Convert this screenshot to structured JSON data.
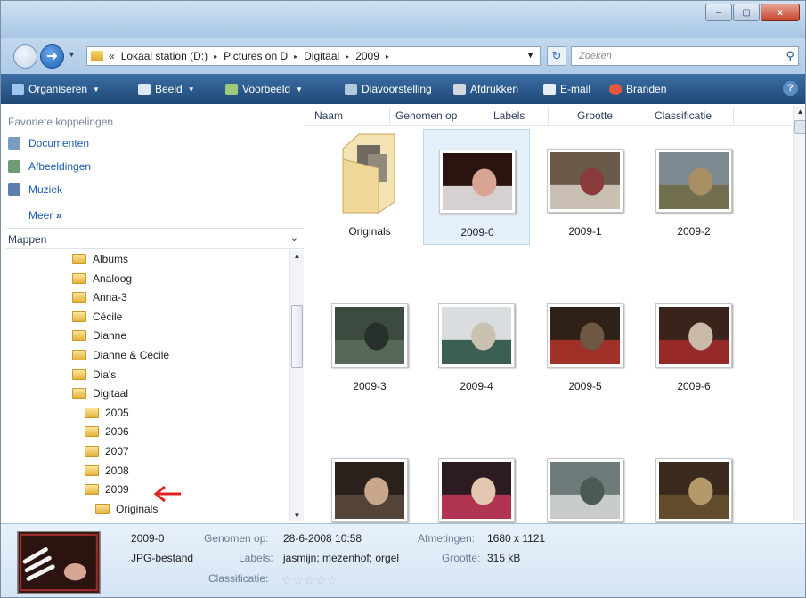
{
  "window": {
    "controls": {
      "minimize": "–",
      "maximize": "▢",
      "close": "x"
    }
  },
  "address_bar": {
    "overflow": "«",
    "crumbs": [
      "Lokaal station (D:)",
      "Pictures on D",
      "Digitaal",
      "2009"
    ],
    "separator": "▸",
    "search_placeholder": "Zoeken"
  },
  "toolbar": {
    "items": [
      "Organiseren",
      "Beeld",
      "Voorbeeld",
      "Diavoorstelling",
      "Afdrukken",
      "E-mail",
      "Branden"
    ],
    "help": "?"
  },
  "nav": {
    "favorites_title": "Favoriete koppelingen",
    "favorites": [
      "Documenten",
      "Afbeeldingen",
      "Muziek"
    ],
    "more": "Meer",
    "more_glyph": "»",
    "folders_title": "Mappen",
    "tree": [
      {
        "label": "Albums",
        "depth": 1
      },
      {
        "label": "Analoog",
        "depth": 1
      },
      {
        "label": "Anna-3",
        "depth": 1
      },
      {
        "label": "Cécile",
        "depth": 1
      },
      {
        "label": "Dianne",
        "depth": 1
      },
      {
        "label": "Dianne & Cécile",
        "depth": 1
      },
      {
        "label": "Dia's",
        "depth": 1
      },
      {
        "label": "Digitaal",
        "depth": 1
      },
      {
        "label": "2005",
        "depth": 2
      },
      {
        "label": "2006",
        "depth": 2
      },
      {
        "label": "2007",
        "depth": 2
      },
      {
        "label": "2008",
        "depth": 2
      },
      {
        "label": "2009",
        "depth": 2,
        "selected": true
      },
      {
        "label": "Originals",
        "depth": 3
      }
    ]
  },
  "columns": [
    "Naam",
    "Genomen op",
    "Labels",
    "Grootte",
    "Classificatie"
  ],
  "files": [
    {
      "name": "Originals",
      "type": "folder"
    },
    {
      "name": "2009-0",
      "type": "photo",
      "selected": true
    },
    {
      "name": "2009-1",
      "type": "photo"
    },
    {
      "name": "2009-2",
      "type": "photo"
    },
    {
      "name": "2009-3",
      "type": "photo"
    },
    {
      "name": "2009-4",
      "type": "photo"
    },
    {
      "name": "2009-5",
      "type": "photo"
    },
    {
      "name": "2009-6",
      "type": "photo"
    },
    {
      "name": "",
      "type": "photo"
    },
    {
      "name": "",
      "type": "photo"
    },
    {
      "name": "",
      "type": "photo"
    },
    {
      "name": "",
      "type": "photo"
    }
  ],
  "details": {
    "name": "2009-0",
    "filetype": "JPG-bestand",
    "taken_label": "Genomen op:",
    "taken_value": "28-6-2008 10:58",
    "labels_label": "Labels:",
    "labels_value": "jasmijn; mezenhof; orgel",
    "rating_label": "Classificatie:",
    "rating_stars": 0,
    "dimensions_label": "Afmetingen:",
    "dimensions_value": "1680 x 1121",
    "size_label": "Grootte:",
    "size_value": "315 kB"
  }
}
